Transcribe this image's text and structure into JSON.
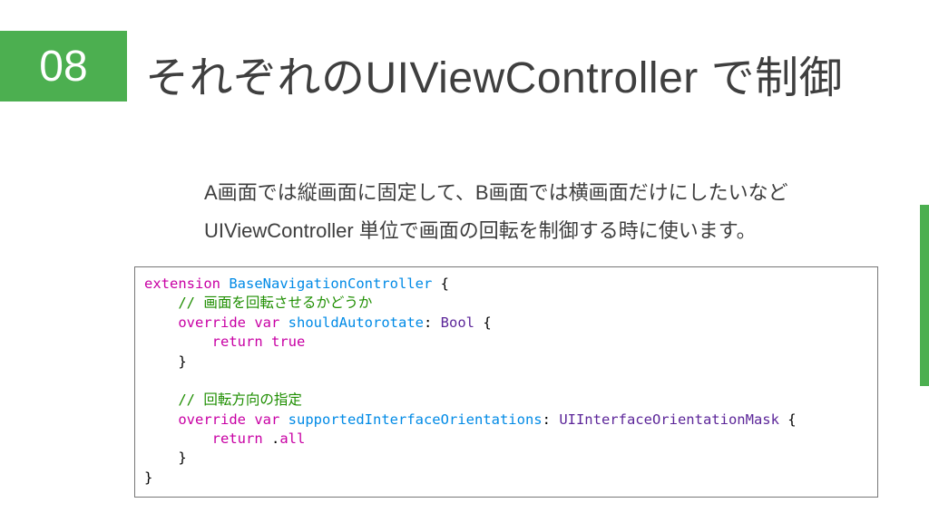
{
  "slide": {
    "number": "08",
    "title": "それぞれのUIViewController で制御"
  },
  "description": {
    "line1": "A画面では縦画面に固定して、B画面では横画面だけにしたいなど",
    "line2": "UIViewController 単位で画面の回転を制御する時に使います。"
  },
  "code": {
    "l1a": "extension",
    "l1b": " ",
    "l1c": "BaseNavigationController",
    "l1d": " {",
    "l2": "    // 画面を回転させるかどうか",
    "l3a": "    ",
    "l3b": "override",
    "l3c": " ",
    "l3d": "var",
    "l3e": " ",
    "l3f": "shouldAutorotate",
    "l3g": ": ",
    "l3h": "Bool",
    "l3i": " {",
    "l4a": "        ",
    "l4b": "return",
    "l4c": " ",
    "l4d": "true",
    "l5": "    }",
    "blank1": " ",
    "l6": "    // 回転方向の指定",
    "l7a": "    ",
    "l7b": "override",
    "l7c": " ",
    "l7d": "var",
    "l7e": " ",
    "l7f": "supportedInterfaceOrientations",
    "l7g": ": ",
    "l7h": "UIInterfaceOrientationMask",
    "l7i": " {",
    "l8a": "        ",
    "l8b": "return",
    "l8c": " .",
    "l8d": "all",
    "l9": "    }",
    "l10": "}"
  }
}
